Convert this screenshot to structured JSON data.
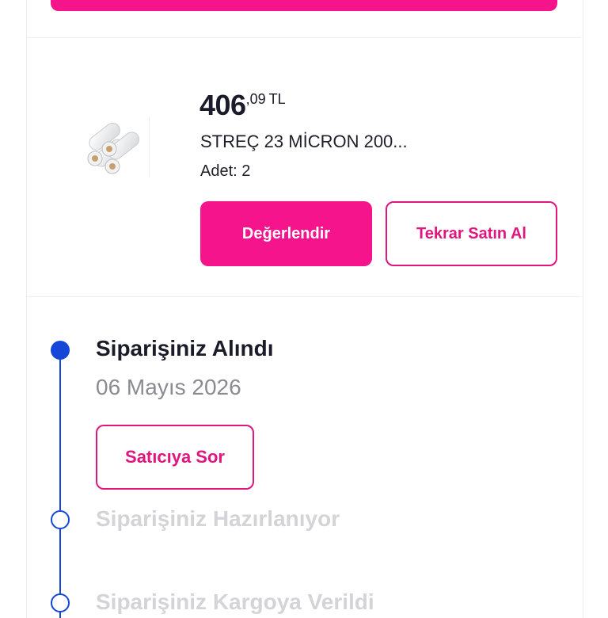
{
  "product": {
    "price_int": "406",
    "price_dec": ",09",
    "currency": "TL",
    "name": "STREÇ 23 MİCRON 200...",
    "quantity": "Adet: 2",
    "rate_button": "Değerlendir",
    "rebuy_button": "Tekrar Satın Al"
  },
  "timeline": {
    "steps": [
      {
        "title": "Siparişiniz Alındı",
        "date": "06 Mayıs 2026",
        "status": "done"
      },
      {
        "title": "Siparişiniz Hazırlanıyor",
        "status": "pending"
      },
      {
        "title": "Siparişiniz Kargoya Verildi",
        "status": "pending"
      }
    ],
    "ask_seller_button": "Satıcıya Sor"
  },
  "colors": {
    "accent": "#f5148c",
    "timeline": "#1446d8",
    "pending_text": "#d4d4d8"
  }
}
